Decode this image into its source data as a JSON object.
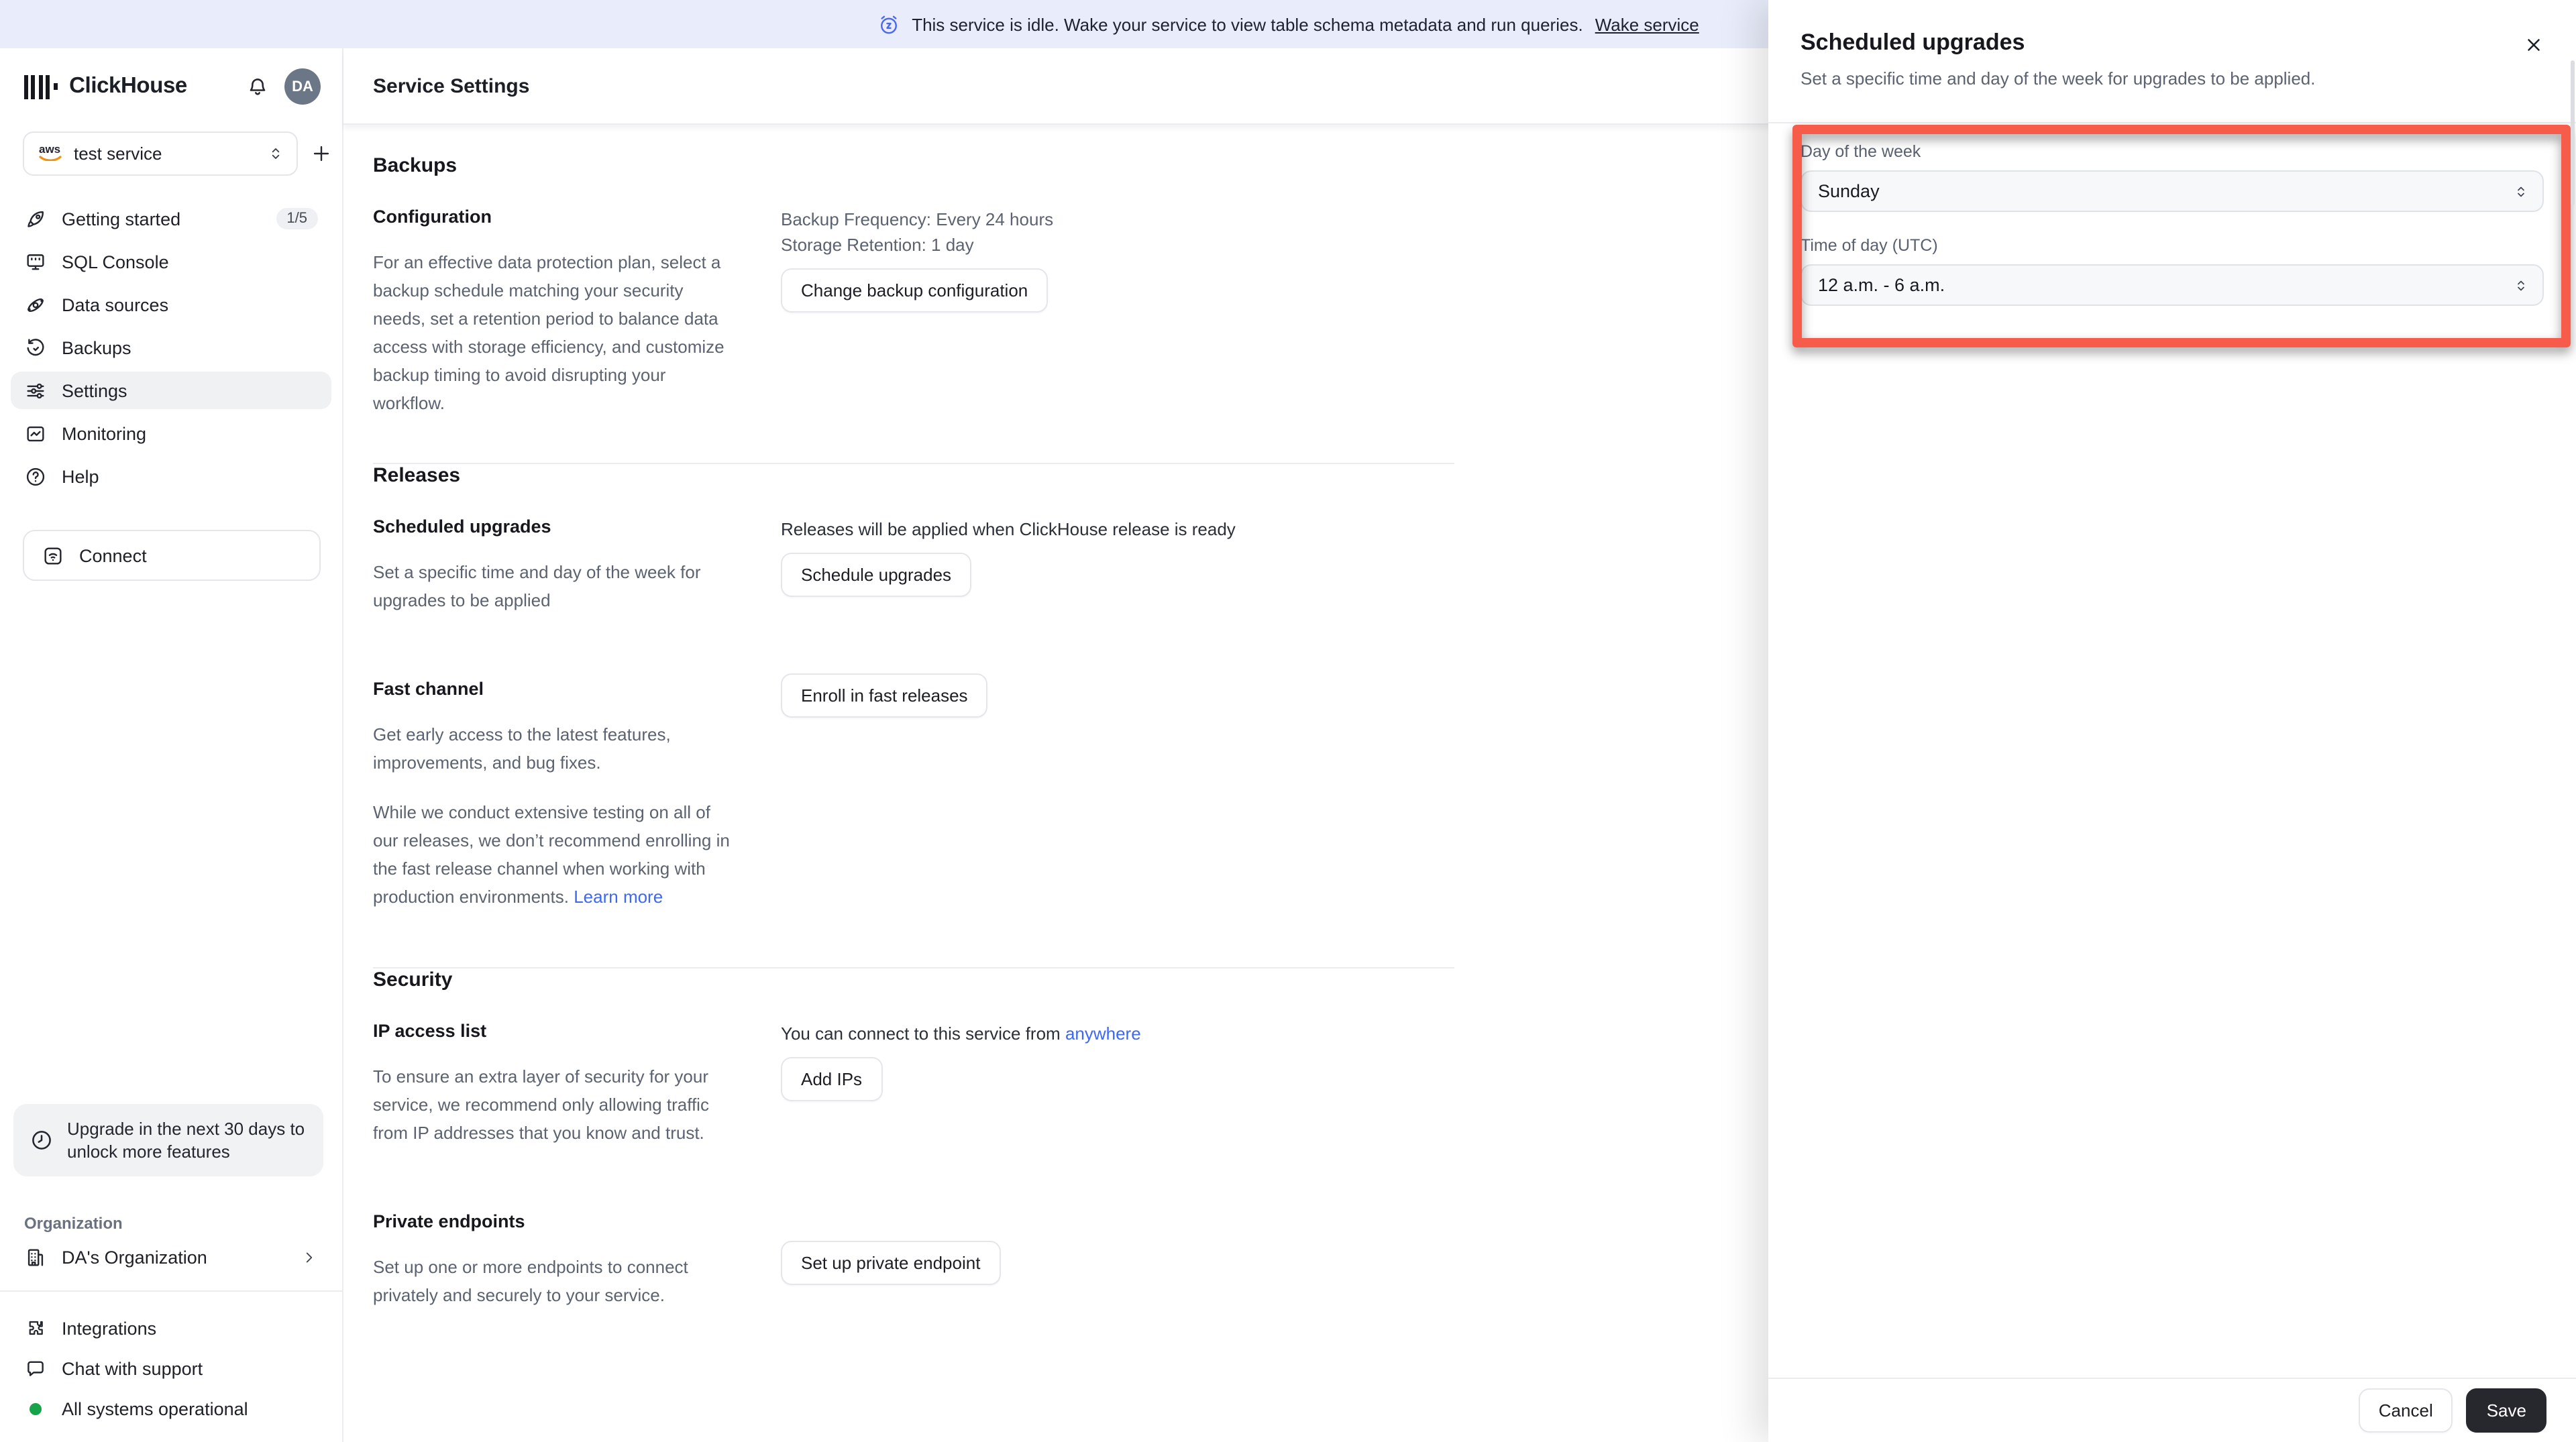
{
  "banner": {
    "icon": "snooze-alarm-icon",
    "text": "This service is idle. Wake your service to view table schema metadata and run queries.",
    "link_label": "Wake service",
    "background_color": "#e9edfb",
    "icon_color": "#4c66f0"
  },
  "sidebar": {
    "brand": "ClickHouse",
    "notifications_icon": "bell-icon",
    "avatar_initials": "DA",
    "service_selector": {
      "provider_icon": "aws-logo",
      "value": "test service",
      "chevron_icon": "up-down-chevron-icon"
    },
    "add_service_icon": "plus-icon",
    "nav": [
      {
        "label": "Getting started",
        "icon": "rocket-icon",
        "badge": "1/5"
      },
      {
        "label": "SQL Console",
        "icon": "sql-console-icon"
      },
      {
        "label": "Data sources",
        "icon": "orbit-icon"
      },
      {
        "label": "Backups",
        "icon": "history-clock-icon"
      },
      {
        "label": "Settings",
        "icon": "sliders-icon"
      },
      {
        "label": "Monitoring",
        "icon": "chart-icon"
      },
      {
        "label": "Help",
        "icon": "help-circle-icon"
      }
    ],
    "connect_label": "Connect",
    "connect_icon": "wifi-box-icon",
    "upgrade_notice": "Upgrade in the next 30 days to unlock more features",
    "upgrade_icon": "clock-icon",
    "organization_label": "Organization",
    "organization_name": "DA's Organization",
    "organization_icon": "building-icon",
    "footer": {
      "integrations": "Integrations",
      "integrations_icon": "puzzle-icon",
      "chat": "Chat with support",
      "chat_icon": "chat-bubble-icon",
      "status": "All systems operational",
      "status_color": "#18a34a"
    }
  },
  "main": {
    "title": "Service Settings",
    "backups": {
      "heading": "Backups",
      "row_title": "Configuration",
      "description": "For an effective data protection plan, select a backup schedule matching your security needs, set a retention period to balance data access with storage efficiency, and customize backup timing to avoid disrupting your workflow.",
      "frequency": "Backup Frequency: Every 24 hours",
      "retention": "Storage Retention: 1 day",
      "button": "Change backup configuration"
    },
    "releases": {
      "heading": "Releases",
      "scheduled": {
        "row_title": "Scheduled upgrades",
        "description": "Set a specific time and day of the week for upgrades to be applied",
        "note": "Releases will be applied when ClickHouse release is ready",
        "button": "Schedule upgrades"
      },
      "fast_channel": {
        "row_title": "Fast channel",
        "description_1": "Get early access to the latest features, improvements, and bug fixes.",
        "description_2": "While we conduct extensive testing on all of our releases, we don’t recommend enrolling in the fast release channel when working with production environments.",
        "link": "Learn more",
        "button": "Enroll in fast releases"
      }
    },
    "security": {
      "heading": "Security",
      "ip_access": {
        "row_title": "IP access list",
        "description": "To ensure an extra layer of security for your service, we recommend only allowing traffic from IP addresses that you know and trust.",
        "note_prefix": "You can connect to this service from ",
        "note_link": "anywhere",
        "button": "Add IPs"
      },
      "private_endpoints": {
        "row_title": "Private endpoints",
        "description": "Set up one or more endpoints to connect privately and securely to your service.",
        "button": "Set up private endpoint"
      }
    }
  },
  "panel": {
    "title": "Scheduled upgrades",
    "subtitle": "Set a specific time and day of the week for upgrades to be applied.",
    "close_icon": "close-icon",
    "fields": {
      "day": {
        "label": "Day of the week",
        "value": "Sunday"
      },
      "time": {
        "label": "Time of day (UTC)",
        "value": "12 a.m. - 6 a.m."
      }
    },
    "cancel_label": "Cancel",
    "save_label": "Save",
    "highlight_color": "#f75b4a",
    "link_color": "#3d68f5"
  }
}
